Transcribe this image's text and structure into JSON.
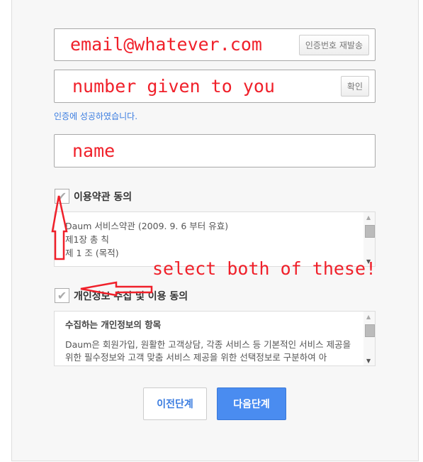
{
  "email_field": {
    "value": "email@whatever.com",
    "button": "인증번호 재발송"
  },
  "code_field": {
    "value": "number given to you",
    "button": "확인"
  },
  "verify_status": "인증에 성공하였습니다.",
  "name_field": {
    "value": "name"
  },
  "terms": {
    "label": "이용약관 동의",
    "checked": true,
    "lines": [
      "Daum 서비스약관 (2009. 9. 6 부터 유효)",
      "제1장 총 칙",
      "제 1 조 (목적)"
    ]
  },
  "privacy": {
    "label": "개인정보 수집 및 이용 동의",
    "checked": true,
    "heading": "수집하는 개인정보의 항목",
    "body": "Daum은 회원가입, 원활한 고객상담, 각종 서비스 등 기본적인 서비스 제공을 위한 필수정보와 고객 맞춤 서비스 제공을 위한 선택정보로 구분하여 아"
  },
  "annotation": "select both of these!",
  "buttons": {
    "prev": "이전단계",
    "next": "다음단계"
  },
  "colors": {
    "annotation": "#f0202a",
    "accent": "#4a8cf0"
  }
}
